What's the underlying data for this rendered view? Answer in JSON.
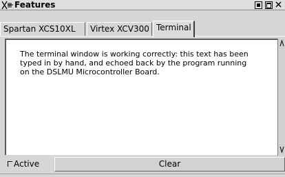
{
  "window": {
    "title": "Features",
    "buttons": [
      "minimize-icon",
      "maximize-icon",
      "close-icon"
    ]
  },
  "tabs": [
    {
      "label": "Spartan XCS10XL",
      "selected": false
    },
    {
      "label": "Virtex XCV300",
      "selected": false
    },
    {
      "label": "Terminal",
      "selected": true
    }
  ],
  "terminal": {
    "text": "The terminal window is working correctly: this text has been\ntyped in by hand, and echoed back by the program running\non the DSLMU Microcontroller Board."
  },
  "controls": {
    "active_label": "Active",
    "active_checked": false,
    "clear_label": "Clear"
  }
}
